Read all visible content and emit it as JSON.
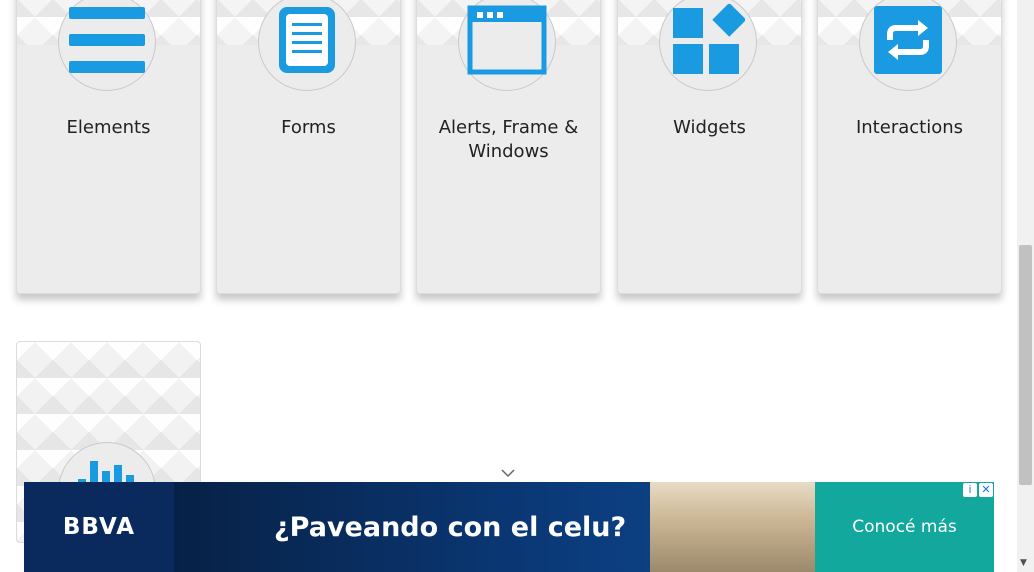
{
  "cards": [
    {
      "title": "Elements",
      "icon": "hamburger-menu-icon"
    },
    {
      "title": "Forms",
      "icon": "document-icon"
    },
    {
      "title": "Alerts, Frame & Windows",
      "icon": "browser-window-icon"
    },
    {
      "title": "Widgets",
      "icon": "widgets-blocks-icon"
    },
    {
      "title": "Interactions",
      "icon": "repeat-arrows-icon"
    }
  ],
  "partial_card": {
    "icon": "bar-chart-icon"
  },
  "ad": {
    "brand": "BBVA",
    "headline": "¿Paveando con el celu?",
    "cta": "Conocé más",
    "info_symbol": "i",
    "close_symbol": "✕"
  },
  "colors": {
    "accent": "#1a9ae0",
    "card_bg": "#ececec",
    "ad_bg": "#072146",
    "ad_cta_bg": "#12a89d"
  }
}
